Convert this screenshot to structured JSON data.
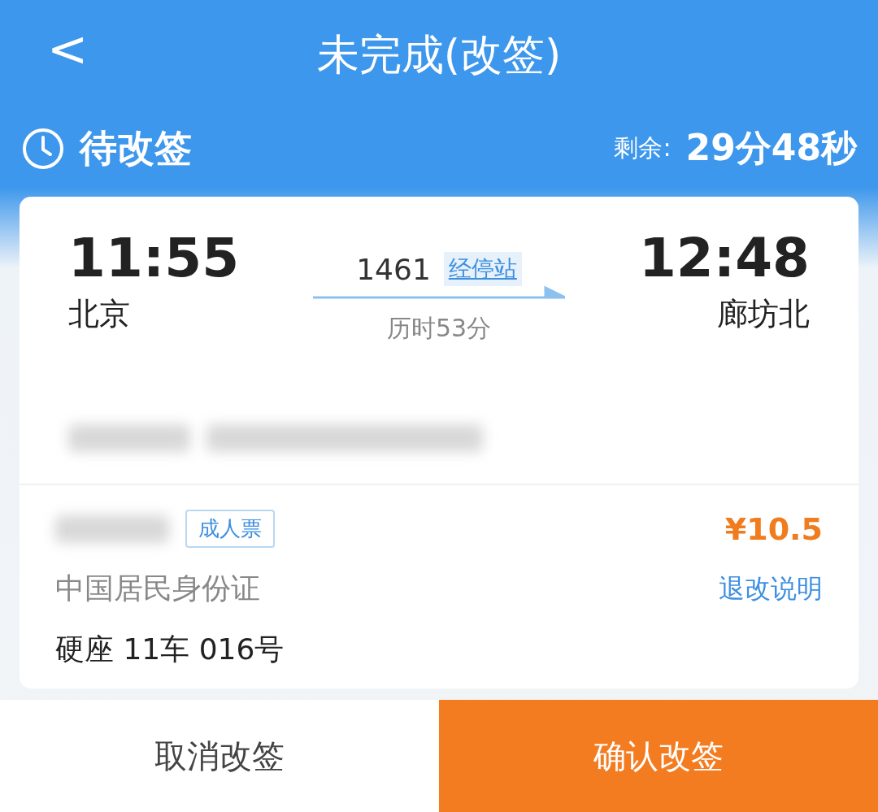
{
  "header": {
    "back": "<",
    "title": "未完成(改签)"
  },
  "status": {
    "label": "待改签",
    "remaining_label": "剩余:",
    "remaining": "29分48秒"
  },
  "trip": {
    "depart_time": "11:55",
    "depart_station": "北京",
    "train_no": "1461",
    "stops_link": "经停站",
    "duration": "历时53分",
    "arrive_time": "12:48",
    "arrive_station": "廊坊北"
  },
  "passenger": {
    "ticket_type": "成人票",
    "price": "¥10.5",
    "id_type": "中国居民身份证",
    "rules_link": "退改说明",
    "seat": "硬座 11车 016号"
  },
  "buttons": [
    {
      "kind": "secondary",
      "label": "取消改签"
    },
    {
      "kind": "primary",
      "label": "确认改签"
    }
  ]
}
